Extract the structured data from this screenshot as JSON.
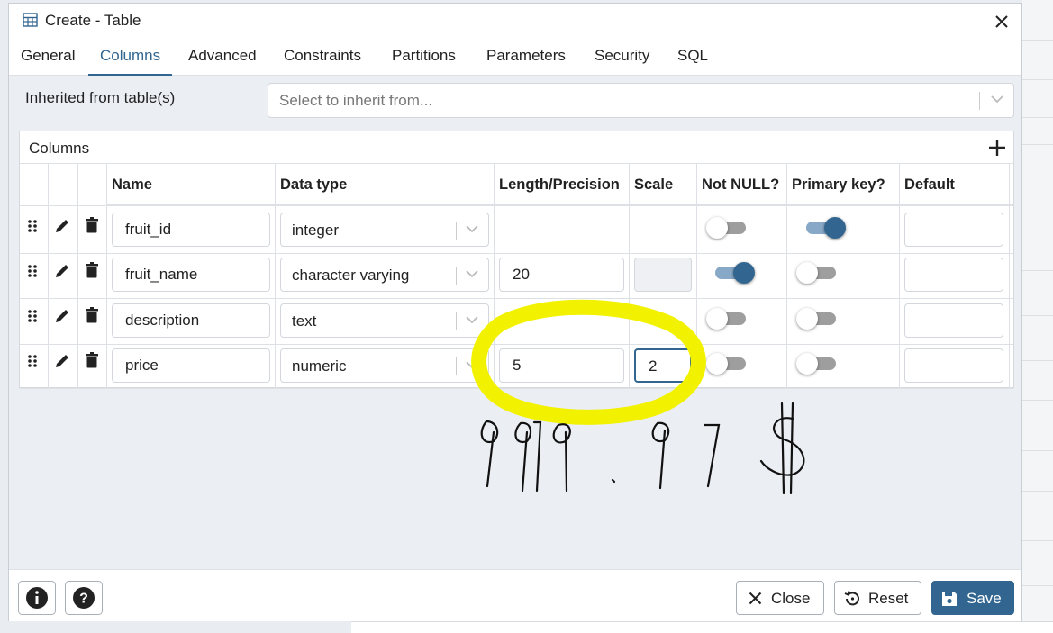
{
  "dialog": {
    "title": "Create - Table",
    "tabs": [
      "General",
      "Columns",
      "Advanced",
      "Constraints",
      "Partitions",
      "Parameters",
      "Security",
      "SQL"
    ],
    "active_tab": "Columns"
  },
  "inherit": {
    "label": "Inherited from table(s)",
    "placeholder": "Select to inherit from..."
  },
  "columns_grid": {
    "title": "Columns",
    "headers": {
      "name": "Name",
      "data_type": "Data type",
      "length": "Length/Precision",
      "scale": "Scale",
      "not_null": "Not NULL?",
      "primary_key": "Primary key?",
      "default": "Default"
    },
    "rows": [
      {
        "name": "fruit_id",
        "data_type": "integer",
        "length": "",
        "scale": "",
        "not_null": false,
        "primary_key": true,
        "default": ""
      },
      {
        "name": "fruit_name",
        "data_type": "character varying",
        "length": "20",
        "scale": "",
        "not_null": true,
        "primary_key": false,
        "default": ""
      },
      {
        "name": "description",
        "data_type": "text",
        "length": "",
        "scale": "",
        "not_null": false,
        "primary_key": false,
        "default": ""
      },
      {
        "name": "price",
        "data_type": "numeric",
        "length": "5",
        "scale": "2",
        "not_null": false,
        "primary_key": false,
        "default": ""
      }
    ]
  },
  "footer": {
    "close_label": "Close",
    "reset_label": "Reset",
    "save_label": "Save"
  },
  "colors": {
    "accent": "#326690",
    "highlight": "#f2f200"
  }
}
